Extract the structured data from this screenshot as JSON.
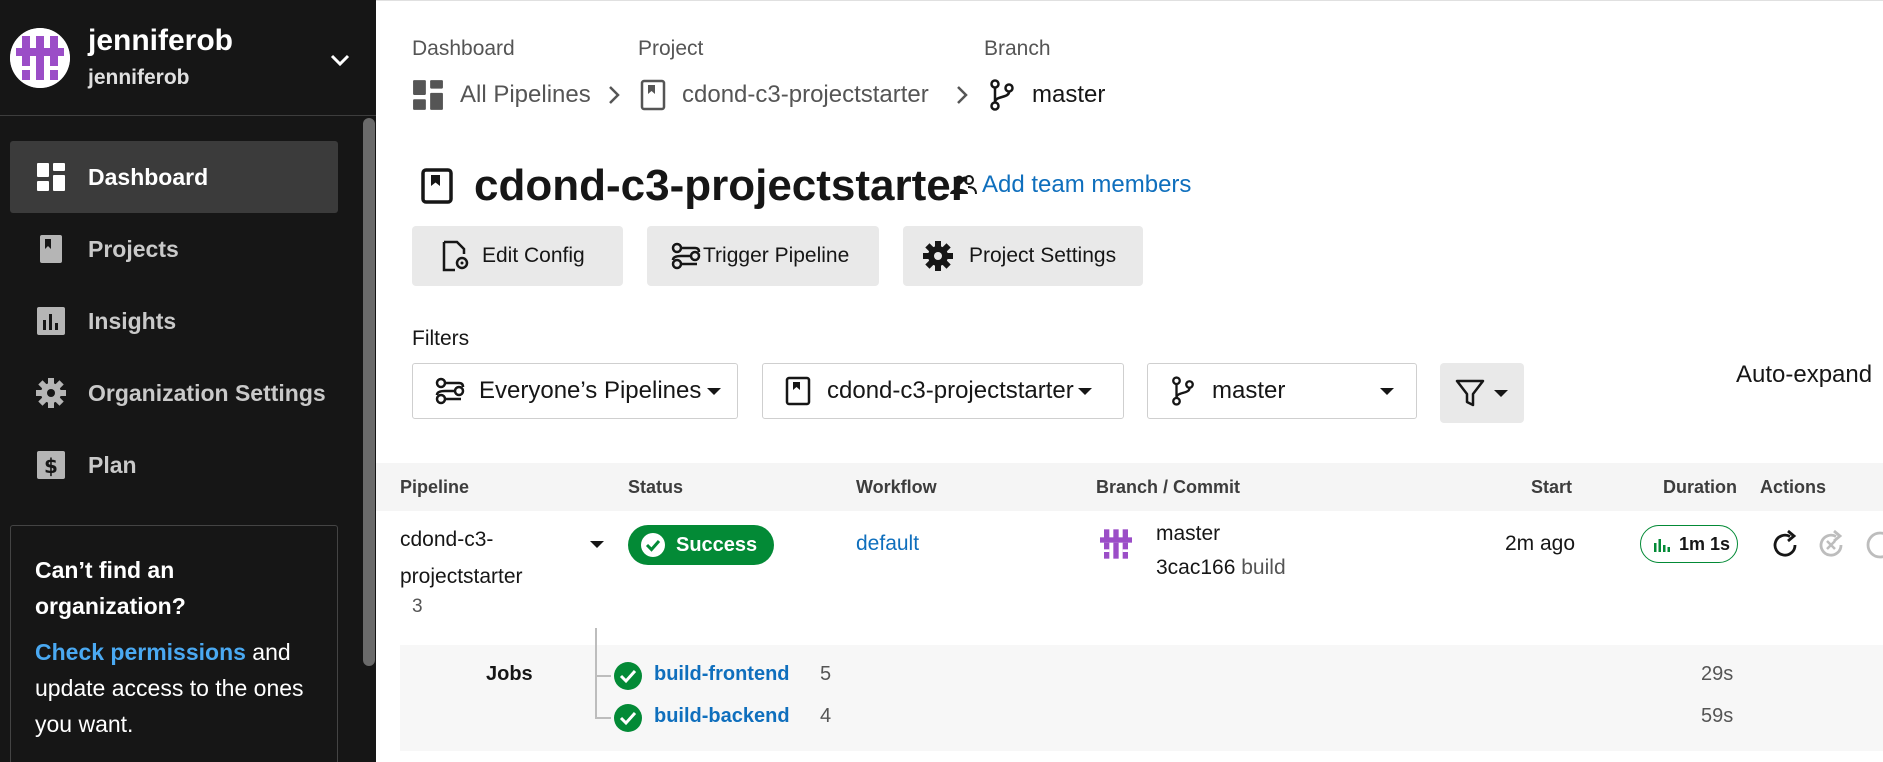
{
  "user": {
    "name": "jenniferob",
    "handle": "jenniferob"
  },
  "sidebar": {
    "items": [
      {
        "label": "Dashboard",
        "icon": "dashboard-icon",
        "active": true
      },
      {
        "label": "Projects",
        "icon": "bookmark-icon",
        "active": false
      },
      {
        "label": "Insights",
        "icon": "insights-icon",
        "active": false
      },
      {
        "label": "Organization Settings",
        "icon": "gear-icon",
        "active": false
      },
      {
        "label": "Plan",
        "icon": "dollar-icon",
        "active": false
      }
    ],
    "help": {
      "title": "Can’t find an organization?",
      "link": "Check permissions",
      "text": " and update access to the ones you want."
    }
  },
  "breadcrumb": {
    "dashboard_label": "Dashboard",
    "dashboard_value": "All Pipelines",
    "project_label": "Project",
    "project_value": "cdond-c3-projectstarter",
    "branch_label": "Branch",
    "branch_value": "master"
  },
  "page": {
    "title": "cdond-c3-projectstarter",
    "add_team": "Add team members",
    "buttons": {
      "edit_config": "Edit Config",
      "trigger": "Trigger Pipeline",
      "settings": "Project Settings"
    }
  },
  "filters": {
    "label": "Filters",
    "pipelines": "Everyone’s Pipelines",
    "project": "cdond-c3-projectstarter",
    "branch": "master",
    "auto_expand": "Auto-expand"
  },
  "table": {
    "headers": {
      "pipeline": "Pipeline",
      "status": "Status",
      "workflow": "Workflow",
      "branch_commit": "Branch / Commit",
      "start": "Start",
      "duration": "Duration",
      "actions": "Actions"
    },
    "row": {
      "pipeline_line1": "cdond-c3-",
      "pipeline_line2": "projectstarter",
      "number": "3",
      "status": "Success",
      "workflow": "default",
      "branch": "master",
      "commit": "3cac166",
      "commit_msg": "build",
      "start": "2m ago",
      "duration": "1m 1s"
    },
    "jobs_label": "Jobs",
    "jobs": [
      {
        "name": "build-frontend",
        "number": "5",
        "duration": "29s"
      },
      {
        "name": "build-backend",
        "number": "4",
        "duration": "59s"
      }
    ]
  },
  "colors": {
    "sidebar_bg": "#161616",
    "success": "#038a36",
    "link": "#0f6fbd",
    "avatar": "#9b4dc7"
  }
}
